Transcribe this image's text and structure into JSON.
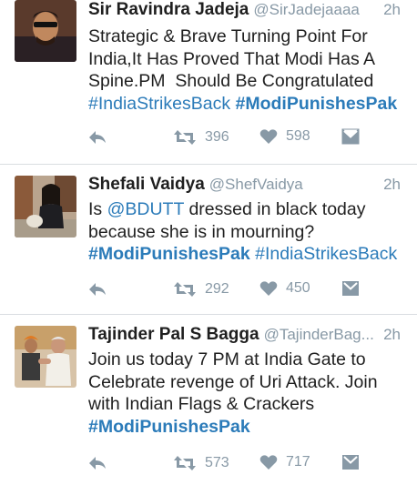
{
  "tweets": [
    {
      "name": "Sir Ravindra Jadeja",
      "handle": "@SirJadejaaaa",
      "time": "2h",
      "body_lines": [
        "Strategic & Brave Turning Point For",
        "India,It Has Proved That Modi Has A",
        "Spine.PM  Should Be Congratulated"
      ],
      "hashtags": [
        "#IndiaStrikesBack",
        "#ModiPunishesPak"
      ],
      "retweets": "396",
      "likes": "598"
    },
    {
      "name": "Shefali Vaidya",
      "handle": "@ShefVaidya",
      "time": "2h",
      "body_line1_mention": "@BDUTT",
      "body_line1_prefix": "Is ",
      "body_line1_suffix": " dressed in black today",
      "body_line2": "because she is in mourning?",
      "hashtags": [
        "#ModiPunishesPak",
        "#IndiaStrikesBack"
      ],
      "retweets": "292",
      "likes": "450"
    },
    {
      "name": "Tajinder Pal S Bagga",
      "handle": "@TajinderBag...",
      "time": "2h",
      "body_lines": [
        "Join us today 7 PM at India Gate to",
        "Celebrate revenge of Uri Attack. Join",
        "with Indian Flags & Crackers"
      ],
      "hashtags": [
        "#ModiPunishesPak"
      ],
      "retweets": "573",
      "likes": "717"
    }
  ],
  "icons": {
    "reply": "reply-icon",
    "retweet": "retweet-icon",
    "like": "heart-icon",
    "message": "direct-message-icon"
  },
  "colors": {
    "link": "#2b7bb9",
    "meta": "#8899a6",
    "icon": "#8899a6"
  }
}
